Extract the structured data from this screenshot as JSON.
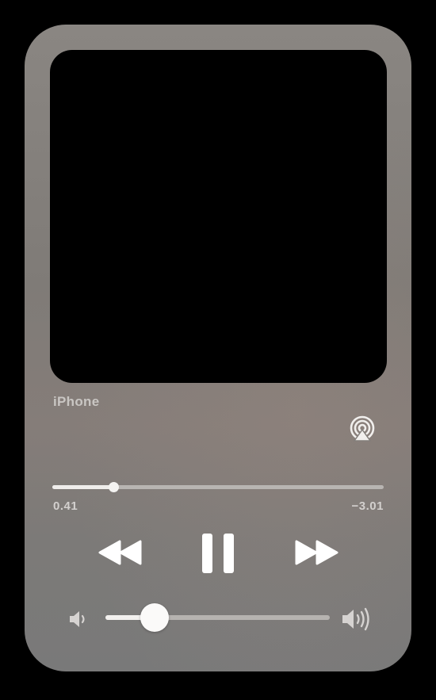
{
  "player": {
    "device_name": "iPhone",
    "elapsed_time": "0.41",
    "remaining_time": "−3.01",
    "progress_fraction": 0.185,
    "volume_fraction": 0.22,
    "state": "playing"
  },
  "icons": {
    "airplay": "airplay-icon",
    "rewind": "rewind-icon",
    "pause": "pause-icon",
    "fast_forward": "fast-forward-icon",
    "volume_low": "volume-low-icon",
    "volume_high": "volume-high-icon"
  },
  "colors": {
    "card": "#827e7a",
    "artwork": "#000000",
    "controls": "#ffffff",
    "text": "#d3d0ce"
  }
}
